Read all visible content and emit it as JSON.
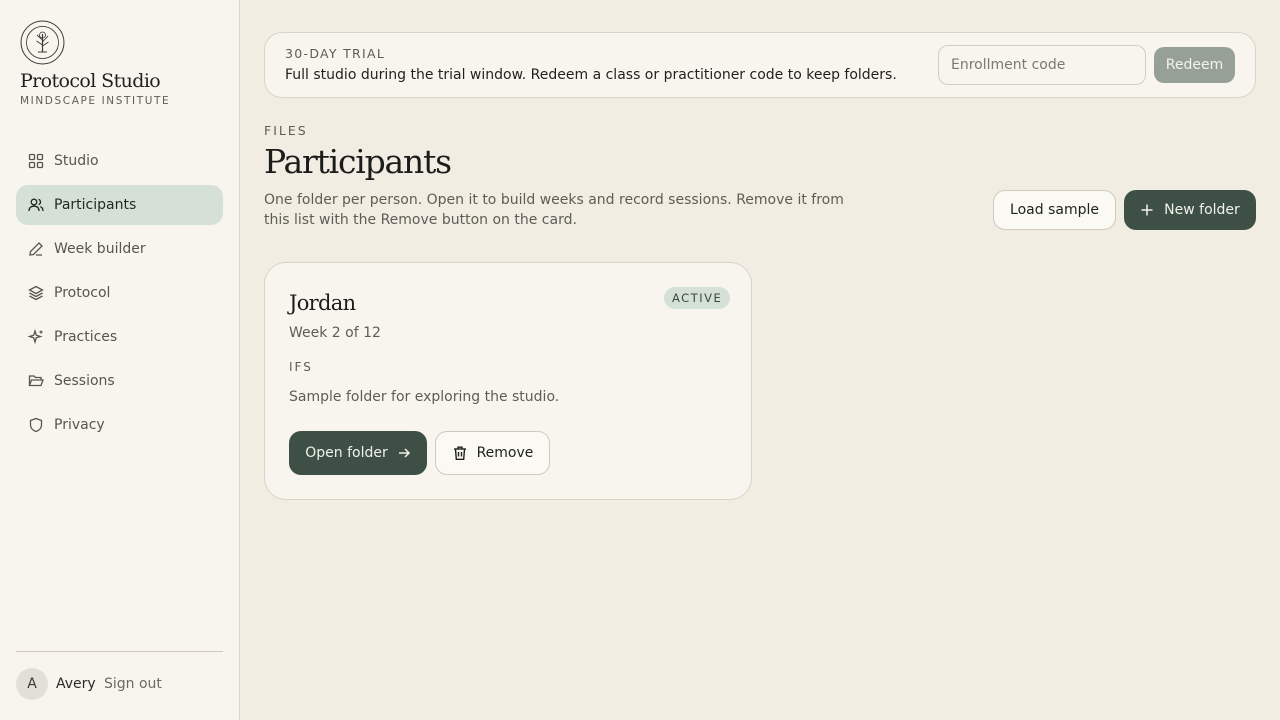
{
  "brand": {
    "name": "Protocol Studio",
    "org": "MINDSCAPE INSTITUTE",
    "logo_icon": "tree-seal-icon"
  },
  "sidebar": {
    "items": [
      {
        "label": "Studio",
        "icon": "grid-icon",
        "active": false
      },
      {
        "label": "Participants",
        "icon": "users-icon",
        "active": true
      },
      {
        "label": "Week builder",
        "icon": "pencil-icon",
        "active": false
      },
      {
        "label": "Protocol",
        "icon": "layers-icon",
        "active": false
      },
      {
        "label": "Practices",
        "icon": "sparkle-icon",
        "active": false
      },
      {
        "label": "Sessions",
        "icon": "folder-open-icon",
        "active": false
      },
      {
        "label": "Privacy",
        "icon": "shield-icon",
        "active": false
      }
    ],
    "user": {
      "initial": "A",
      "name": "Avery",
      "sign_out": "Sign out"
    }
  },
  "trial": {
    "tag": "30-DAY TRIAL",
    "message": "Full studio during the trial window. Redeem a class or practitioner code to keep folders.",
    "input_placeholder": "Enrollment code",
    "input_value": "",
    "redeem_label": "Redeem"
  },
  "main": {
    "section_tag": "FILES",
    "title": "Participants",
    "description": "One folder per person. Open it to build weeks and record sessions. Remove it from this list with the Remove button on the card.",
    "load_sample_label": "Load sample",
    "new_folder_label": "New folder"
  },
  "folders": [
    {
      "name": "Jordan",
      "status": "ACTIVE",
      "week": "Week 2 of 12",
      "modality": "IFS",
      "note": "Sample folder for exploring the studio.",
      "open_label": "Open folder",
      "remove_label": "Remove"
    }
  ],
  "colors": {
    "accent": "#3e5045",
    "active_nav": "#d5e0d6",
    "background": "#f1ede3",
    "panel": "#f8f5ee"
  }
}
